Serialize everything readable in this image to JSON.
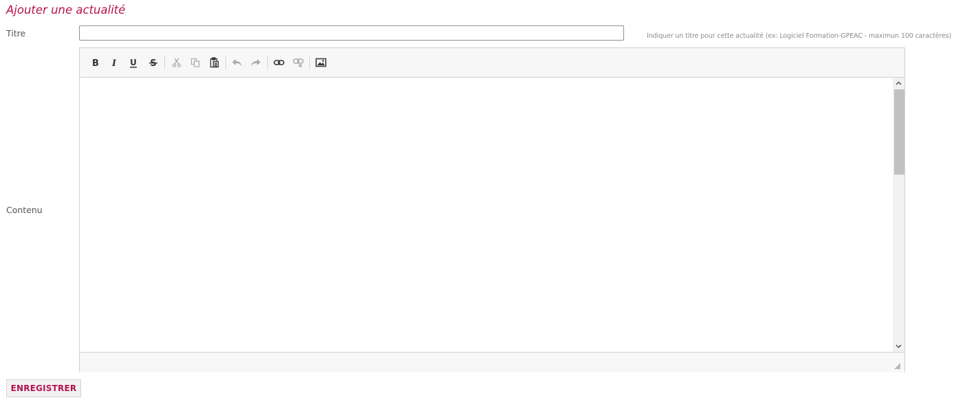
{
  "page": {
    "title": "Ajouter une actualité"
  },
  "form": {
    "titre_label": "Titre",
    "titre_value": "",
    "titre_hint": "Indiquer un titre pour cette actualité (ex: Logiciel Formation-GPEAC - maximun 100 caractères)",
    "contenu_label": "Contenu",
    "contenu_value": "",
    "submit_label": "ENREGISTRER"
  },
  "editor": {
    "toolbar": [
      {
        "name": "bold-icon",
        "enabled": true
      },
      {
        "name": "italic-icon",
        "enabled": true
      },
      {
        "name": "underline-icon",
        "enabled": true
      },
      {
        "name": "strikethrough-icon",
        "enabled": true
      },
      {
        "name": "cut-icon",
        "enabled": false
      },
      {
        "name": "copy-icon",
        "enabled": false
      },
      {
        "name": "paste-icon",
        "enabled": true
      },
      {
        "name": "undo-icon",
        "enabled": false
      },
      {
        "name": "redo-icon",
        "enabled": false
      },
      {
        "name": "link-icon",
        "enabled": true
      },
      {
        "name": "unlink-icon",
        "enabled": false
      },
      {
        "name": "image-icon",
        "enabled": true
      }
    ]
  },
  "colors": {
    "accent": "#b5134f",
    "icon": "#333333",
    "icon_disabled": "#a8a8a8"
  }
}
